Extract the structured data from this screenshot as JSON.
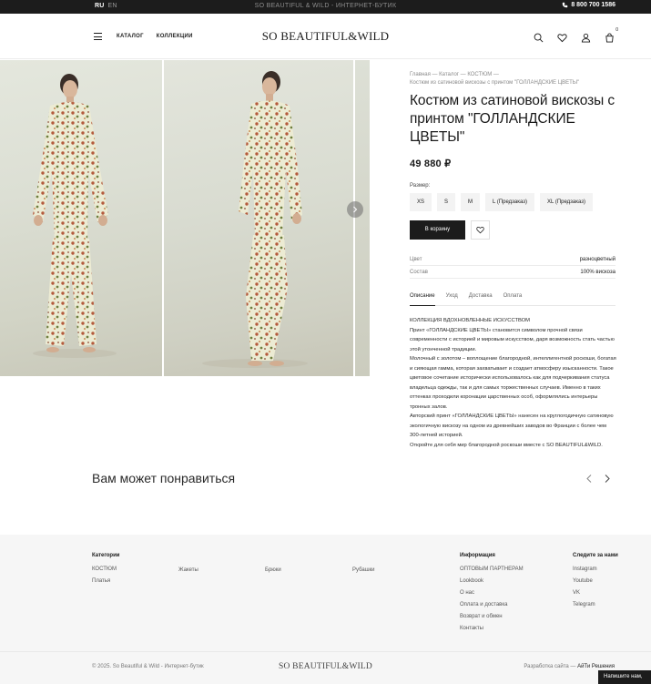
{
  "topbar": {
    "lang_active": "RU",
    "lang_inactive": "EN",
    "tagline": "SO BEAUTIFUL & WILD - ИНТЕРНЕТ-БУТИК",
    "phone": "8 800 700 1586"
  },
  "header": {
    "nav": [
      "КАТАЛОГ",
      "КОЛЛЕКЦИИ"
    ],
    "logo": "SO BEAUTIFUL&WILD",
    "cart_count": "0"
  },
  "product": {
    "breadcrumb_line1": "Главная — Каталог — КОСТЮМ —",
    "breadcrumb_line2": "Костюм из сатиновой вискозы с принтом \"ГОЛЛАНДСКИЕ ЦВЕТЫ\"",
    "title": "Костюм из сатиновой вискозы с принтом \"ГОЛЛАНДСКИЕ ЦВЕТЫ\"",
    "price": "49 880 ₽",
    "size_label": "Размер:",
    "sizes": [
      "XS",
      "S",
      "M",
      "L (Предзаказ)",
      "XL (Предзаказ)"
    ],
    "cart_button": "В корзину",
    "props": [
      {
        "key": "Цвет",
        "value": "разноцветный"
      },
      {
        "key": "Состав",
        "value": "100% вискоза"
      }
    ],
    "tabs": [
      "Описание",
      "Уход",
      "Доставка",
      "Оплата"
    ],
    "description": [
      "КОЛЛЕКЦИЯ ВДОХНОВЛЕННЫЕ ИСКУССТВОМ",
      "Принт «ГОЛЛАНДСКИЕ ЦВЕТЫ» становится символом прочной связи современности с историей и мировым искусством, даря возможность стать частью этой утонченной традиции.",
      "Молочный с золотом – воплощение благородной, интеллигентной роскоши, богатая и сияющая гамма, которая захватывает и создает атмосферу изысканности. Такое цветовое сочетание исторически использовалось как для подчеркивания статуса владельца одежды, так и для самых торжественных случаев. Именно в таких оттенках проходили коронации царственных особ, оформлялись интерьеры тронных залов.",
      "Авторский принт «ГОЛЛАНДСКИЕ ЦВЕТЫ» нанесен на круглогодичную сатиновую экологичную вискозу на одном из древнейших заводов во Франции с более чем 300-летней историей.",
      "Откройте для себя мир благородной роскоши вместе с SO BEAUTIFUL&WILD."
    ]
  },
  "recs": {
    "title": "Вам может понравиться"
  },
  "footer": {
    "categories_heading": "Категории",
    "categories": [
      "КОСТЮМ",
      "Платья",
      "Жакеты",
      "Брюки",
      "Рубашки"
    ],
    "info_heading": "Информация",
    "info_links": [
      "ОПТОВЫМ ПАРТНЕРАМ",
      "Lookbook",
      "О нас",
      "Оплата и доставка",
      "Возврат и обмен",
      "Контакты"
    ],
    "social_heading": "Следите за нами",
    "social_links": [
      "Instagram",
      "Youtube",
      "VK",
      "Telegram"
    ],
    "copyright": "© 2025. So Beautiful & Wild - Интернет-бутик",
    "logo": "SO BEAUTIFUL&WILD",
    "dev_label": "Разработка сайта —",
    "dev_name": "АйТи Решения",
    "chat": "Напишите нам,"
  },
  "colors": {
    "topbar_bg": "#1c1c1c",
    "cart_button_bg": "#1c1c1c",
    "footer_bg": "#f6f6f6"
  }
}
